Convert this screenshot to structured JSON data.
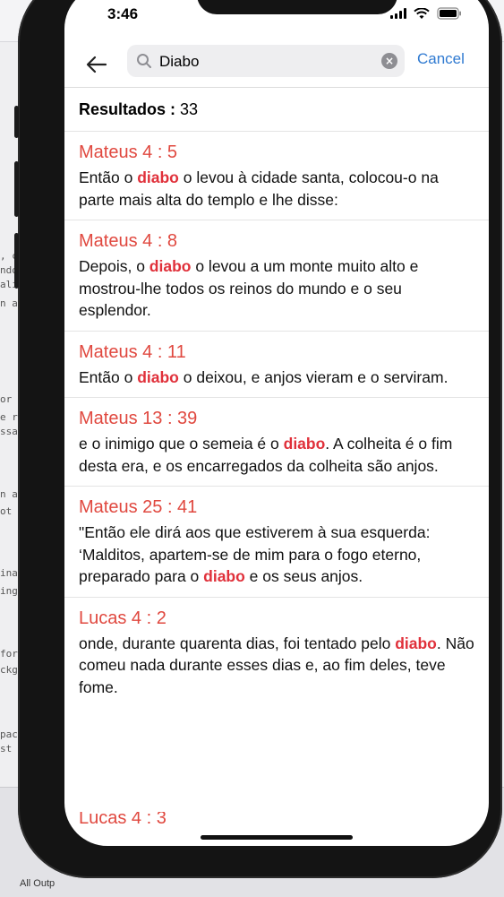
{
  "status_bar": {
    "time": "3:46"
  },
  "search": {
    "value": "Diabo",
    "cancel_label": "Cancel",
    "clear_label": "×"
  },
  "results": {
    "label": "Resultados :",
    "count": "33"
  },
  "verses": [
    {
      "ref": "Mateus  4 : 5",
      "before": "Então o ",
      "highlight": "diabo",
      "after": " o levou à cidade santa, colocou-o na parte mais alta do templo e lhe disse:"
    },
    {
      "ref": "Mateus  4 : 8",
      "before": "Depois, o ",
      "highlight": "diabo",
      "after": " o levou a um monte muito alto e mostrou-lhe todos os reinos do mundo e o seu esplendor."
    },
    {
      "ref": "Mateus  4 : 11",
      "before": "Então o ",
      "highlight": "diabo",
      "after": " o deixou, e anjos vieram e o serviram."
    },
    {
      "ref": "Mateus  13 : 39",
      "before": "e o inimigo que o semeia é o ",
      "highlight": "diabo",
      "after": ". A colheita é o fim desta era, e os encarregados da colheita são anjos."
    },
    {
      "ref": "Mateus  25 : 41",
      "before": "\"Então ele dirá aos que estiverem à sua esquerda: ‘Malditos, apartem-se de mim para o fogo eterno, preparado para o ",
      "highlight": "diabo",
      "after": " e os seus anjos."
    },
    {
      "ref": "Lucas  4 : 2",
      "before": "onde, durante quarenta dias, foi tentado pelo ",
      "highlight": "diabo",
      "after": ". Não comeu nada durante esses dias e, ao fim deles, teve fome."
    }
  ],
  "next_ref_partial": "Lucas  4 : 3",
  "background": {
    "code_lines": [
      ", c",
      "ndo",
      "ali",
      "n a",
      "or ",
      "e r",
      "ssa",
      "n a",
      "ot",
      "ina",
      "ing",
      "for",
      "ckg",
      "pac",
      " st"
    ],
    "bottom_label": "All Outp"
  },
  "colors": {
    "reference": "#e0483f",
    "highlight": "#e0303a",
    "accent": "#2f7ad1"
  },
  "icons": [
    "back-arrow-icon",
    "search-icon",
    "clear-icon",
    "signal-icon",
    "wifi-icon",
    "battery-icon"
  ]
}
